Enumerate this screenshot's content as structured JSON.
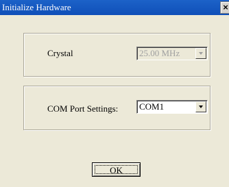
{
  "window": {
    "title": "Initialize Hardware",
    "close_label": "×"
  },
  "crystal": {
    "label": "Crystal",
    "value": "25.00 MHz",
    "enabled": false
  },
  "com_port": {
    "label": "COM Port Settings:",
    "value": "COM1",
    "enabled": true
  },
  "ok_button": {
    "label": "OK"
  },
  "icons": {
    "dropdown_arrow": "chevron-down-icon",
    "close": "close-icon"
  },
  "colors": {
    "titlebar": "#1c62c8",
    "dialog_background": "#ece9d8",
    "disabled_text": "#a0a0a0"
  }
}
